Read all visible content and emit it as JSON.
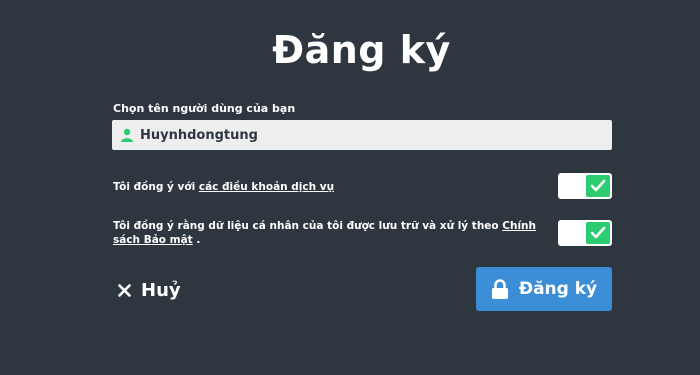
{
  "page": {
    "title": "Đăng ký"
  },
  "username": {
    "label": "Chọn tên người dùng của bạn",
    "value": "Huynhdongtung",
    "icon": "user-icon"
  },
  "terms": {
    "prefix": "Tôi đồng ý với ",
    "link": "các điều khoản dịch vụ",
    "checked": true
  },
  "privacy": {
    "prefix": "Tôi đồng ý rằng dữ liệu cá nhân của tôi được lưu trữ và xử lý theo ",
    "link": "Chính sách Bảo mật",
    "suffix": " .",
    "checked": true
  },
  "actions": {
    "cancel_label": "Huỷ",
    "submit_label": "Đăng ký"
  },
  "colors": {
    "background": "#2e3640",
    "accent": "#3b8ed6",
    "toggle_on": "#2ecc71"
  }
}
